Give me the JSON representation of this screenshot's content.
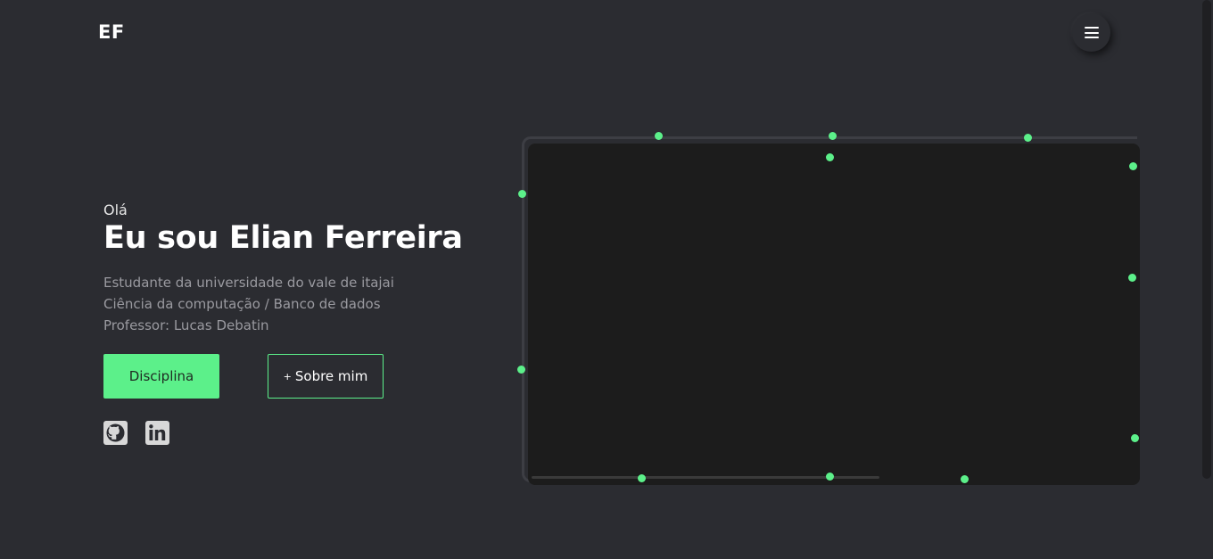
{
  "header": {
    "logo": "EF",
    "menu_icon": "hamburger-menu-icon"
  },
  "hero": {
    "greeting": "Olá",
    "name": "Eu sou Elian Ferreira",
    "description": [
      "Estudante da universidade do vale de itajai",
      "Ciência da computação / Banco de dados",
      "Professor: Lucas Debatin"
    ],
    "primary_button": "Disciplina",
    "secondary_button_prefix": "+",
    "secondary_button": "Sobre mim"
  },
  "social": [
    {
      "name": "github",
      "icon": "github-icon"
    },
    {
      "name": "linkedin",
      "icon": "linkedin-icon"
    }
  ],
  "colors": {
    "background": "#2b2c31",
    "accent": "#5cf08a",
    "screen": "#1c1c1c",
    "muted_text": "#9a9aa0"
  }
}
